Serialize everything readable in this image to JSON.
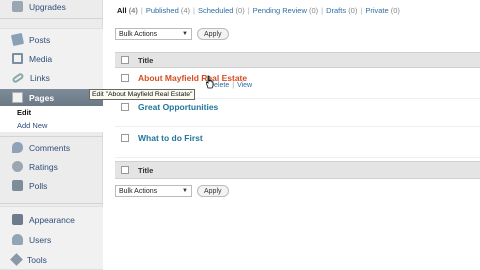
{
  "sidebar": {
    "items": [
      {
        "label": "Upgrades",
        "icon": "upgrades-icon"
      },
      {
        "label": "Posts",
        "icon": "posts-icon"
      },
      {
        "label": "Media",
        "icon": "media-icon"
      },
      {
        "label": "Links",
        "icon": "links-icon"
      },
      {
        "label": "Pages",
        "icon": "pages-icon"
      },
      {
        "label": "Comments",
        "icon": "comments-icon"
      },
      {
        "label": "Ratings",
        "icon": "ratings-icon"
      },
      {
        "label": "Polls",
        "icon": "polls-icon"
      },
      {
        "label": "Appearance",
        "icon": "appearance-icon"
      },
      {
        "label": "Users",
        "icon": "users-icon"
      },
      {
        "label": "Tools",
        "icon": "tools-icon"
      }
    ],
    "pages_submenu": [
      {
        "label": "Edit"
      },
      {
        "label": "Add New"
      }
    ]
  },
  "filters": {
    "all": {
      "label": "All",
      "count": "(4)"
    },
    "published": {
      "label": "Published",
      "count": "(4)"
    },
    "scheduled": {
      "label": "Scheduled",
      "count": "(0)"
    },
    "pending": {
      "label": "Pending Review",
      "count": "(0)"
    },
    "drafts": {
      "label": "Drafts",
      "count": "(0)"
    },
    "private": {
      "label": "Private",
      "count": "(0)"
    },
    "separator": "|"
  },
  "bulk_actions": {
    "top": {
      "select_label": "Bulk Actions",
      "apply_label": "Apply"
    },
    "bottom": {
      "select_label": "Bulk Actions",
      "apply_label": "Apply"
    }
  },
  "table": {
    "header": {
      "title": "Title"
    },
    "footer": {
      "title": "Title"
    },
    "rows": [
      {
        "title": "About Mayfield Real Estate",
        "hovered": true
      },
      {
        "title": "Great Opportunities",
        "hovered": false
      },
      {
        "title": "What to do First",
        "hovered": false
      }
    ],
    "row_actions": {
      "delete": "Delete",
      "view": "View",
      "separator": "|"
    }
  },
  "tooltip": {
    "text": "Edit \"About Mayfield Real Estate\""
  },
  "colors": {
    "link_blue": "#2e6da4",
    "hover_title_orange": "#d54e21",
    "row_title_blue": "#21759b",
    "pages_active_bg": "#7e8c9a"
  }
}
